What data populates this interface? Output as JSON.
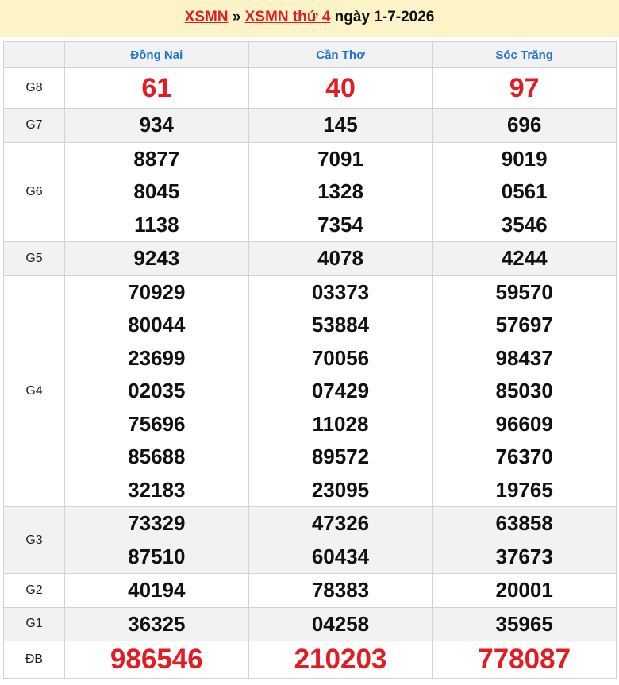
{
  "header": {
    "link1": "XSMN",
    "separator": " » ",
    "link2": "XSMN thứ 4",
    "date_text": " ngày 1-7-2026"
  },
  "provinces": [
    "Đồng Nai",
    "Cần Thơ",
    "Sóc Trăng"
  ],
  "prizes": {
    "g8": {
      "label": "G8",
      "values": [
        "61",
        "40",
        "97"
      ]
    },
    "g7": {
      "label": "G7",
      "values": [
        "934",
        "145",
        "696"
      ]
    },
    "g6": {
      "label": "G6",
      "values": [
        [
          "8877",
          "8045",
          "1138"
        ],
        [
          "7091",
          "1328",
          "7354"
        ],
        [
          "9019",
          "0561",
          "3546"
        ]
      ]
    },
    "g5": {
      "label": "G5",
      "values": [
        "9243",
        "4078",
        "4244"
      ]
    },
    "g4": {
      "label": "G4",
      "values": [
        [
          "70929",
          "80044",
          "23699",
          "02035",
          "75696",
          "85688",
          "32183"
        ],
        [
          "03373",
          "53884",
          "70056",
          "07429",
          "11028",
          "89572",
          "23095"
        ],
        [
          "59570",
          "57697",
          "98437",
          "85030",
          "96609",
          "76370",
          "19765"
        ]
      ]
    },
    "g3": {
      "label": "G3",
      "values": [
        [
          "73329",
          "87510"
        ],
        [
          "47326",
          "60434"
        ],
        [
          "63858",
          "37673"
        ]
      ]
    },
    "g2": {
      "label": "G2",
      "values": [
        "40194",
        "78383",
        "20001"
      ]
    },
    "g1": {
      "label": "G1",
      "values": [
        "36325",
        "04258",
        "35965"
      ]
    },
    "db": {
      "label": "ĐB",
      "values": [
        "986546",
        "210203",
        "778087"
      ]
    }
  },
  "colors": {
    "accent_red": "#e31b23",
    "link_blue": "#1e73d6",
    "header_bg": "#fcf3c9"
  }
}
